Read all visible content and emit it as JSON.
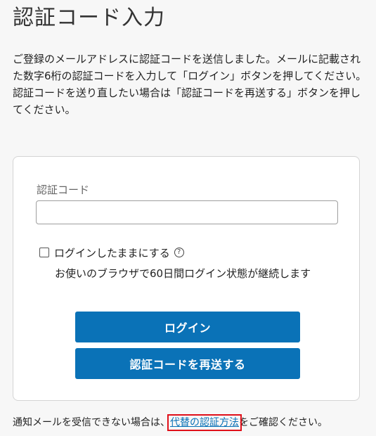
{
  "header": {
    "title": "認証コード入力"
  },
  "description": {
    "line1": "ご登録のメールアドレスに認証コードを送信しました。メールに記載された数字6桁の認証コードを入力して「ログイン」ボタンを押してください。",
    "line2": "認証コードを送り直したい場合は「認証コードを再送する」ボタンを押してください。"
  },
  "form": {
    "code_label": "認証コード",
    "code_value": "",
    "code_placeholder": "",
    "remember_label": "ログインしたままにする",
    "help_icon_glyph": "?",
    "remember_note": "お使いのブラウザで60日間ログイン状態が継続します",
    "login_button": "ログイン",
    "resend_button": "認証コードを再送する"
  },
  "footer": {
    "prefix": "通知メールを受信できない場合は、",
    "link": "代替の認証方法",
    "suffix": "をご確認ください。"
  },
  "colors": {
    "primary": "#0a72b7",
    "highlight": "#e0101a",
    "background": "#f7f7f7"
  }
}
